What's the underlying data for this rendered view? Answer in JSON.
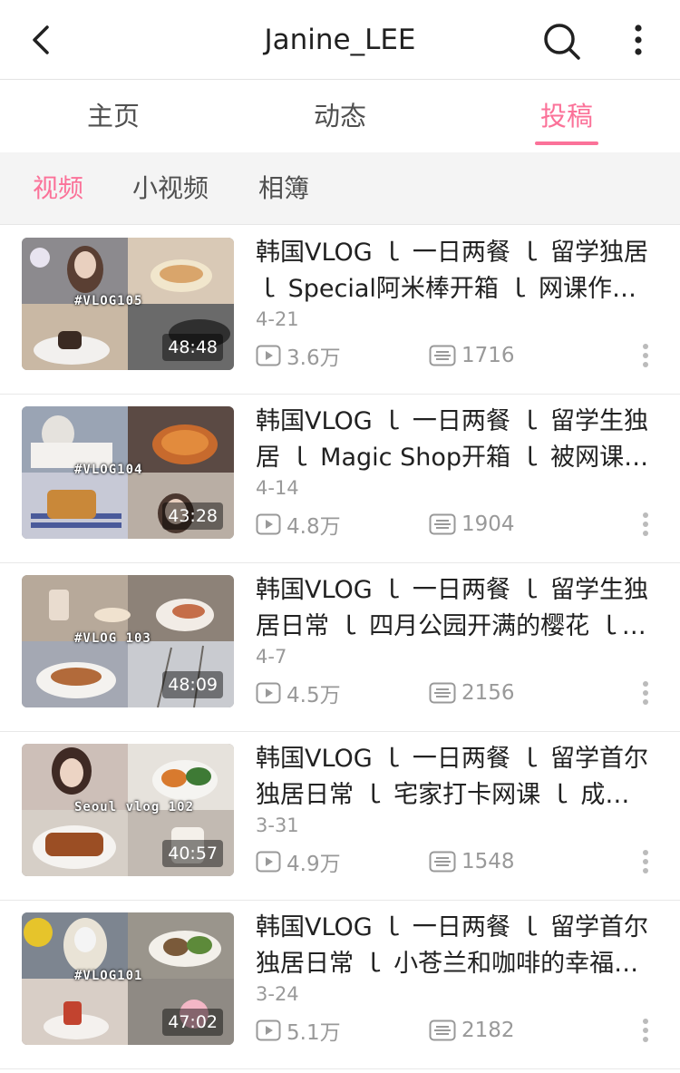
{
  "header": {
    "title": "Janine_LEE",
    "back_icon": "back-arrow-icon",
    "search_icon": "search-icon",
    "more_icon": "more-vertical-icon"
  },
  "tabs": [
    {
      "label": "主页",
      "active": false
    },
    {
      "label": "动态",
      "active": false
    },
    {
      "label": "投稿",
      "active": true
    }
  ],
  "subtabs": [
    {
      "label": "视频",
      "active": true
    },
    {
      "label": "小视频",
      "active": false
    },
    {
      "label": "相簿",
      "active": false
    }
  ],
  "colors": {
    "accent": "#fb7299",
    "text": "#212121",
    "secondary": "#999999"
  },
  "videos": [
    {
      "title": "韩国VLOG ｌ 一日两餐 ｌ 留学独居 ｌ Special阿米棒开箱 ｌ 网课作业…",
      "tag": "#VLOG105",
      "duration": "48:48",
      "date": "4-21",
      "views": "3.6万",
      "danmaku": "1716"
    },
    {
      "title": "韩国VLOG ｌ 一日两餐 ｌ 留学生独居 ｌ Magic Shop开箱 ｌ 被网课…",
      "tag": "#VLOG104",
      "duration": "43:28",
      "date": "4-14",
      "views": "4.8万",
      "danmaku": "1904"
    },
    {
      "title": "韩国VLOG ｌ 一日两餐 ｌ 留学生独居日常 ｌ 四月公园开满的樱花 ｌ…",
      "tag": "#VLOG 103",
      "duration": "48:09",
      "date": "4-7",
      "views": "4.5万",
      "danmaku": "2156"
    },
    {
      "title": "韩国VLOG ｌ 一日两餐 ｌ 留学首尔独居日常 ｌ 宅家打卡网课 ｌ 成…",
      "tag": "Seoul vlog 102",
      "duration": "40:57",
      "date": "3-31",
      "views": "4.9万",
      "danmaku": "1548"
    },
    {
      "title": "韩国VLOG ｌ 一日两餐 ｌ 留学首尔独居日常 ｌ 小苍兰和咖啡的幸福…",
      "tag": "#VLOG101",
      "duration": "47:02",
      "date": "3-24",
      "views": "5.1万",
      "danmaku": "2182"
    }
  ]
}
